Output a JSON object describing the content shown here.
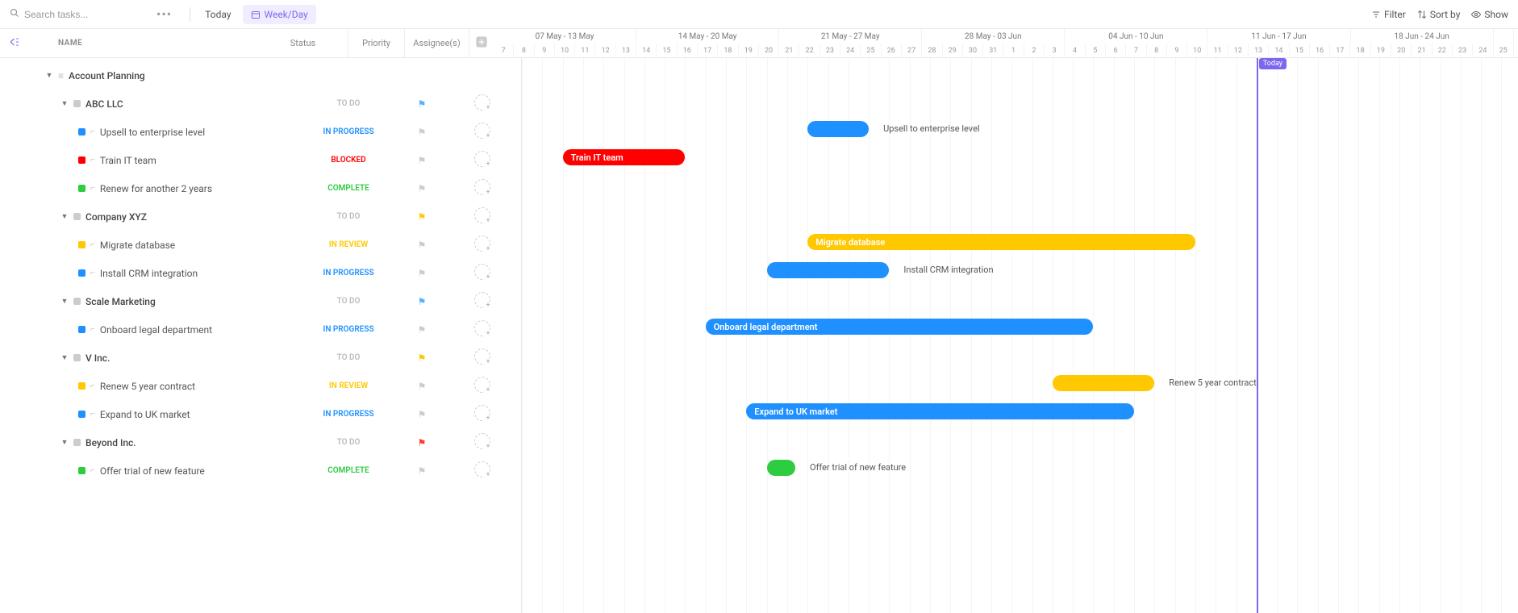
{
  "toolbar": {
    "search_placeholder": "Search tasks...",
    "today": "Today",
    "weekday": "Week/Day",
    "filter": "Filter",
    "sortby": "Sort by",
    "show": "Show"
  },
  "columns": {
    "name": "NAME",
    "status": "Status",
    "priority": "Priority",
    "assignee": "Assignee(s)"
  },
  "root": {
    "name": "Account Planning"
  },
  "groups": [
    {
      "name": "ABC LLC",
      "status": "TO DO",
      "flag": "blue",
      "color": "#ccc",
      "indent": 75,
      "tasks": [
        {
          "name": "Upsell to enterprise level",
          "status": "IN PROGRESS",
          "statusClass": "st-progress",
          "color": "#1e90ff",
          "bar": {
            "start": 21,
            "end": 23,
            "color": "#1e90ff",
            "labelOutside": true
          }
        },
        {
          "name": "Train IT team",
          "status": "BLOCKED",
          "statusClass": "st-blocked",
          "color": "#ff0000",
          "bar": {
            "start": 9,
            "end": 14,
            "color": "#ff0000",
            "labelOutside": false
          }
        },
        {
          "name": "Renew for another 2 years",
          "status": "COMPLETE",
          "statusClass": "st-complete",
          "color": "#2ecc40",
          "bar": null
        }
      ]
    },
    {
      "name": "Company XYZ",
      "status": "TO DO",
      "flag": "yellow",
      "color": "#ccc",
      "indent": 75,
      "tasks": [
        {
          "name": "Migrate database",
          "status": "IN REVIEW",
          "statusClass": "st-review",
          "color": "#ffc800",
          "bar": {
            "start": 21,
            "end": 39,
            "color": "#ffc800",
            "labelOutside": false
          }
        },
        {
          "name": "Install CRM integration",
          "status": "IN PROGRESS",
          "statusClass": "st-progress",
          "color": "#1e90ff",
          "bar": {
            "start": 19,
            "end": 24,
            "color": "#1e90ff",
            "labelOutside": true
          }
        }
      ]
    },
    {
      "name": "Scale Marketing",
      "status": "TO DO",
      "flag": "blue",
      "color": "#ccc",
      "indent": 75,
      "tasks": [
        {
          "name": "Onboard legal department",
          "status": "IN PROGRESS",
          "statusClass": "st-progress",
          "color": "#1e90ff",
          "bar": {
            "start": 16,
            "end": 34,
            "color": "#1e90ff",
            "labelOutside": false
          }
        }
      ]
    },
    {
      "name": "V Inc.",
      "status": "TO DO",
      "flag": "yellow",
      "color": "#ccc",
      "indent": 75,
      "tasks": [
        {
          "name": "Renew 5 year contract",
          "status": "IN REVIEW",
          "statusClass": "st-review",
          "color": "#ffc800",
          "bar": {
            "start": 33,
            "end": 37,
            "color": "#ffc800",
            "labelOutside": true
          }
        },
        {
          "name": "Expand to UK market",
          "status": "IN PROGRESS",
          "statusClass": "st-progress",
          "color": "#1e90ff",
          "bar": {
            "start": 18,
            "end": 36,
            "color": "#1e90ff",
            "labelOutside": false
          }
        }
      ]
    },
    {
      "name": "Beyond Inc.",
      "status": "TO DO",
      "flag": "red",
      "color": "#ccc",
      "indent": 75,
      "tasks": [
        {
          "name": "Offer trial of new feature",
          "status": "COMPLETE",
          "statusClass": "st-complete",
          "color": "#2ecc40",
          "bar": {
            "start": 19,
            "end": 19.4,
            "color": "#2ecc40",
            "labelOutside": true
          }
        }
      ]
    }
  ],
  "timeline": {
    "weeks": [
      {
        "label": "07 May - 13 May",
        "days": 7
      },
      {
        "label": "14 May - 20 May",
        "days": 7
      },
      {
        "label": "21 May - 27 May",
        "days": 7
      },
      {
        "label": "28 May - 03 Jun",
        "days": 7
      },
      {
        "label": "04 Jun - 10 Jun",
        "days": 7
      },
      {
        "label": "11 Jun - 17 Jun",
        "days": 7
      },
      {
        "label": "18 Jun - 24 Jun",
        "days": 7
      },
      {
        "label": "",
        "days": 1
      }
    ],
    "days": [
      "7",
      "8",
      "9",
      "10",
      "11",
      "12",
      "13",
      "14",
      "15",
      "16",
      "17",
      "18",
      "19",
      "20",
      "21",
      "22",
      "23",
      "24",
      "25",
      "26",
      "27",
      "28",
      "29",
      "30",
      "31",
      "1",
      "2",
      "3",
      "4",
      "5",
      "6",
      "7",
      "8",
      "9",
      "10",
      "11",
      "12",
      "13",
      "14",
      "15",
      "16",
      "17",
      "18",
      "19",
      "20",
      "21",
      "22",
      "23",
      "24",
      "25"
    ],
    "todayIndex": 36,
    "todayLabel": "Today",
    "dayWidth": 25.3
  }
}
